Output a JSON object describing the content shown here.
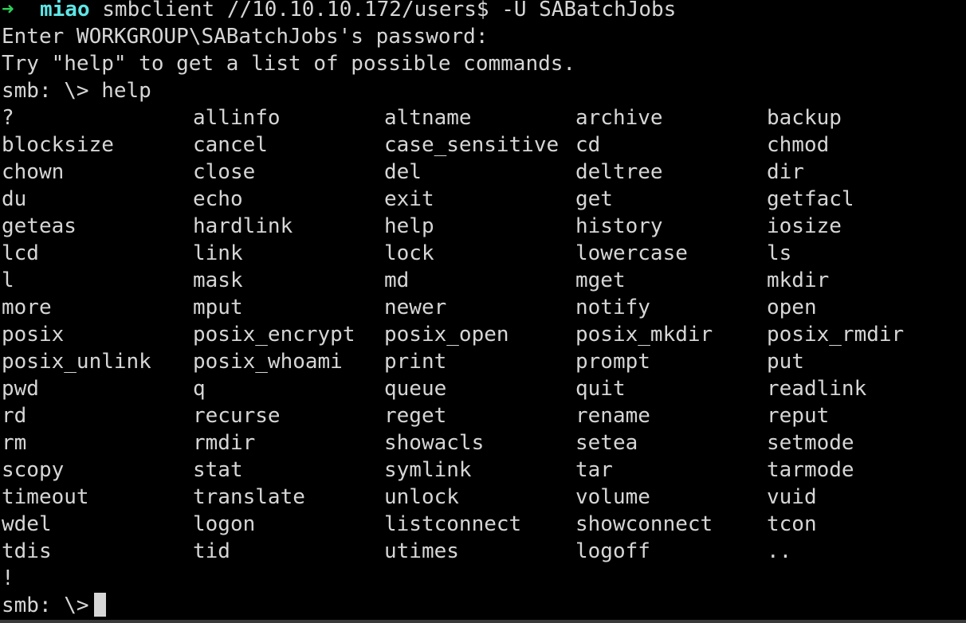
{
  "prompt_line": {
    "arrow": "➜",
    "user": "miao",
    "command": "smbclient //10.10.10.172/users$ -U SABatchJobs"
  },
  "output_lines": [
    "Enter WORKGROUP\\SABatchJobs's password:",
    "Try \"help\" to get a list of possible commands."
  ],
  "help_prompt": "smb: \\> help",
  "commands": [
    [
      "?",
      "allinfo",
      "altname",
      "archive",
      "backup"
    ],
    [
      "blocksize",
      "cancel",
      "case_sensitive",
      "cd",
      "chmod"
    ],
    [
      "chown",
      "close",
      "del",
      "deltree",
      "dir"
    ],
    [
      "du",
      "echo",
      "exit",
      "get",
      "getfacl"
    ],
    [
      "geteas",
      "hardlink",
      "help",
      "history",
      "iosize"
    ],
    [
      "lcd",
      "link",
      "lock",
      "lowercase",
      "ls"
    ],
    [
      "l",
      "mask",
      "md",
      "mget",
      "mkdir"
    ],
    [
      "more",
      "mput",
      "newer",
      "notify",
      "open"
    ],
    [
      "posix",
      "posix_encrypt",
      "posix_open",
      "posix_mkdir",
      "posix_rmdir"
    ],
    [
      "posix_unlink",
      "posix_whoami",
      "print",
      "prompt",
      "put"
    ],
    [
      "pwd",
      "q",
      "queue",
      "quit",
      "readlink"
    ],
    [
      "rd",
      "recurse",
      "reget",
      "rename",
      "reput"
    ],
    [
      "rm",
      "rmdir",
      "showacls",
      "setea",
      "setmode"
    ],
    [
      "scopy",
      "stat",
      "symlink",
      "tar",
      "tarmode"
    ],
    [
      "timeout",
      "translate",
      "unlock",
      "volume",
      "vuid"
    ],
    [
      "wdel",
      "logon",
      "listconnect",
      "showconnect",
      "tcon"
    ],
    [
      "tdis",
      "tid",
      "utimes",
      "logoff",
      ".."
    ],
    [
      "!"
    ]
  ],
  "final_prompt": "smb: \\>",
  "colors": {
    "background": "#000000",
    "text": "#d6d6d6",
    "arrow": "#2fd15a",
    "user": "#5fe6e6"
  }
}
